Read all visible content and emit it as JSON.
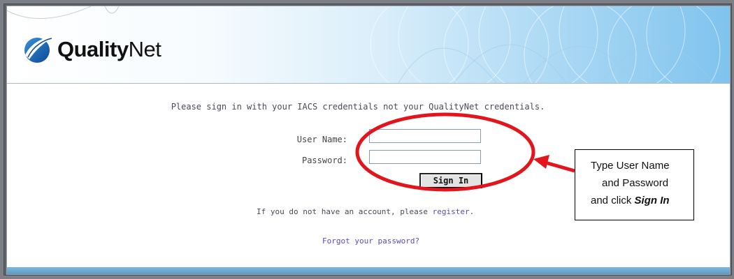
{
  "brand": {
    "name_bold": "Quality",
    "name_light": "Net"
  },
  "login": {
    "instruction": "Please sign in with your IACS credentials not your QualityNet credentials.",
    "username_label": "User Name:",
    "username_value": "",
    "password_label": "Password:",
    "password_value": "",
    "signin_label": "Sign In",
    "register_prefix": "If you do not have an account, please ",
    "register_link": "register",
    "register_suffix": ".",
    "forgot_link": "Forgot your password?"
  },
  "annotation": {
    "line1": "Type User Name",
    "line2": "and Password",
    "line3_prefix": "and click ",
    "line3_emphasis": "Sign In",
    "highlight_color": "#e3141b"
  },
  "icons": {
    "logo": "qualitynet-logo-icon",
    "arrow": "arrow-left-icon"
  }
}
